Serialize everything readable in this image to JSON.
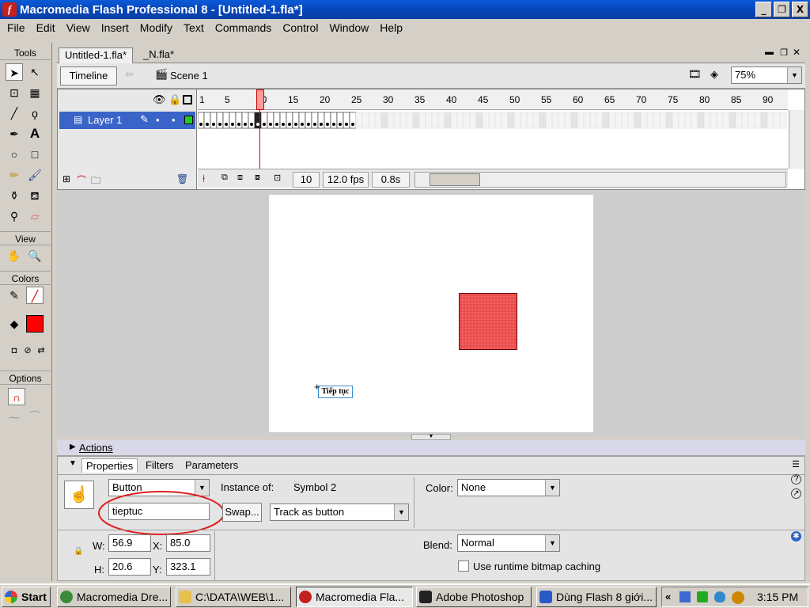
{
  "window": {
    "title": "Macromedia Flash Professional 8 - [Untitled-1.fla*]",
    "min": "_",
    "restore": "❐",
    "close": "X"
  },
  "menu": [
    "File",
    "Edit",
    "View",
    "Insert",
    "Modify",
    "Text",
    "Commands",
    "Control",
    "Window",
    "Help"
  ],
  "tools": {
    "header": "Tools",
    "view_label": "View",
    "colors_label": "Colors",
    "options_label": "Options"
  },
  "doc_tabs": [
    "Untitled-1.fla*",
    "_N.fla*"
  ],
  "editbar": {
    "timeline_label": "Timeline",
    "scene_label": "Scene 1",
    "zoom": "75%"
  },
  "timeline": {
    "layer_name": "Layer 1",
    "ruler": [
      "1",
      "5",
      "10",
      "15",
      "20",
      "25",
      "30",
      "35",
      "40",
      "45",
      "50",
      "55",
      "60",
      "65",
      "70",
      "75",
      "80",
      "85",
      "90"
    ],
    "current_frame": "10",
    "fps": "12.0 fps",
    "time": "0.8s",
    "current_frame_index": 10,
    "last_keyframe": 25
  },
  "stage": {
    "button_text": "Tiếp tục"
  },
  "panels": {
    "actions_label": "Actions",
    "tabs": [
      "Properties",
      "Filters",
      "Parameters"
    ]
  },
  "properties": {
    "symbol_type": "Button",
    "instance_name": "tieptuc",
    "instance_of_label": "Instance of:",
    "instance_of": "Symbol 2",
    "swap_label": "Swap...",
    "track": "Track as button",
    "color_label": "Color:",
    "color_value": "None",
    "w_label": "W:",
    "w": "56.9",
    "h_label": "H:",
    "h": "20.6",
    "x_label": "X:",
    "x": "85.0",
    "y_label": "Y:",
    "y": "323.1",
    "blend_label": "Blend:",
    "blend_value": "Normal",
    "cache_label": "Use runtime bitmap caching"
  },
  "taskbar": {
    "start": "Start",
    "tasks": [
      "Macromedia Dre...",
      "C:\\DATA\\WEB\\1...",
      "Macromedia Fla...",
      "Adobe Photoshop",
      "Dùng Flash 8 giới..."
    ],
    "clock": "3:15 PM",
    "tray_expand": "«"
  },
  "colors": {
    "title_bar": "#0a4cc8",
    "accent_red": "#f05a5a",
    "annotation": "#e02020"
  }
}
